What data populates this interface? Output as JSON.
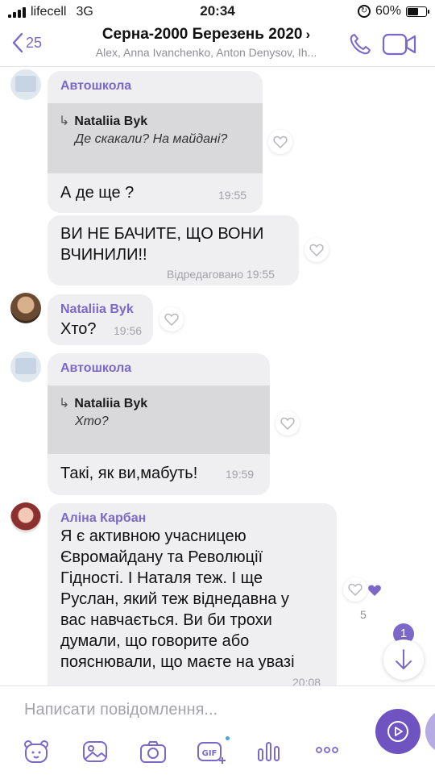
{
  "status_bar": {
    "carrier": "lifecell",
    "network": "3G",
    "time": "20:34",
    "battery": "60%",
    "battery_level": 0.6
  },
  "header": {
    "back_count": "25",
    "title": "Серна-2000 Березень 2020",
    "subtitle": "Alex, Anna Ivanchenko, Anton Denysov, Ih..."
  },
  "messages": [
    {
      "sender": "Автошкола",
      "reply_to_name": "Nataliia Byk",
      "reply_to_text": "Де скакали? На майдані?",
      "text": "А де ще ?",
      "time": "19:55"
    },
    {
      "text_line1": "ВИ НЕ БАЧИТЕ, ЩО ВОНИ",
      "text_line2": "ВЧИНИЛИ!!",
      "edited_label": "Відредаговано",
      "time": "19:55"
    },
    {
      "sender": "Nataliia Byk",
      "text": "Хто?",
      "time": "19:56"
    },
    {
      "sender": "Автошкола",
      "reply_to_name": "Nataliia Byk",
      "reply_to_text": "Хто?",
      "text": "Такі, як ви,мабуть!",
      "time": "19:59"
    },
    {
      "sender": "Аліна Карбан",
      "lines": [
        "Я є активною учасницею",
        "Євромайдану та Революції",
        "Гідності. І Наталя теж. І ще",
        "Руслан, який теж віднедавна у",
        "вас навчається. Ви би трохи",
        "думали, що говорите або",
        "пояснювали, що маєте на увазі"
      ],
      "time": "20:08",
      "like_count": "5"
    }
  ],
  "unread_badge": "1",
  "composer": {
    "placeholder": "Написати повідомлення..."
  },
  "icons": {
    "accent": "#7b68c8",
    "send_bg": "#6f53c1"
  }
}
